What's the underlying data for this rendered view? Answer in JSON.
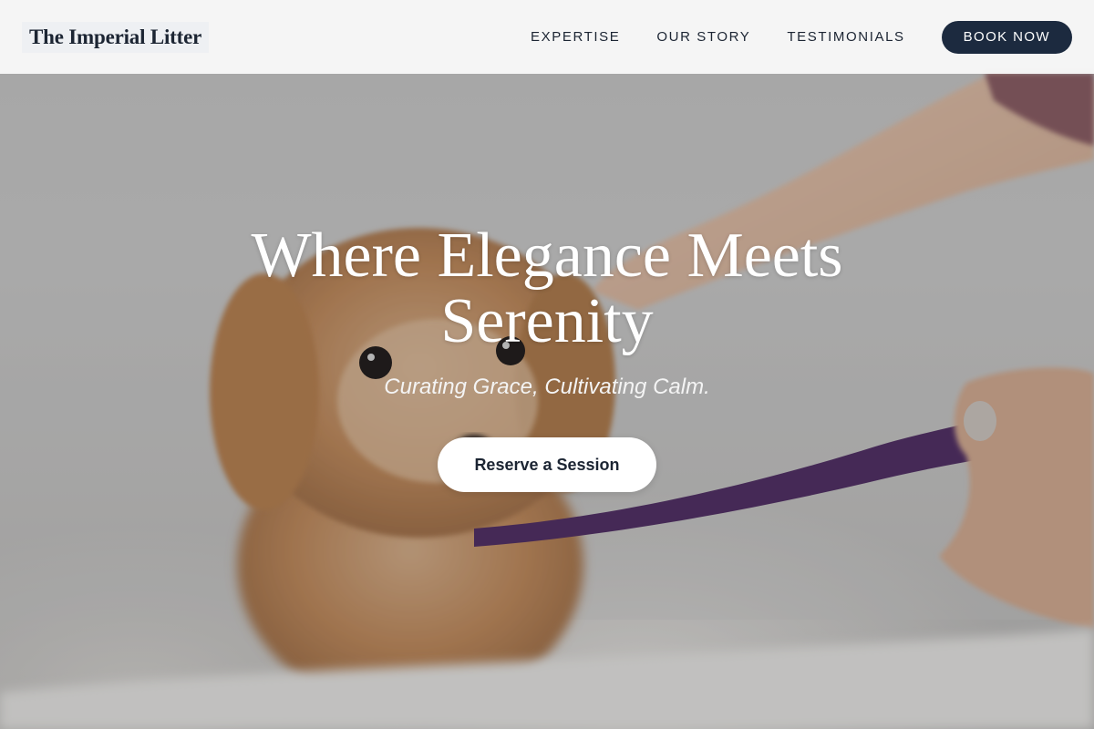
{
  "header": {
    "logo_text": "The Imperial Litter",
    "nav": [
      {
        "label": "EXPERTISE"
      },
      {
        "label": "OUR STORY"
      },
      {
        "label": "TESTIMONIALS"
      }
    ],
    "book_label": "BOOK NOW"
  },
  "hero": {
    "title": "Where Elegance Meets Serenity",
    "subtitle": "Curating Grace, Cultivating Calm.",
    "cta_label": "Reserve a Session"
  },
  "colors": {
    "navy": "#1c2a3f",
    "text_dark": "#1c2533",
    "white": "#ffffff",
    "leash_purple": "#4e2a63"
  }
}
